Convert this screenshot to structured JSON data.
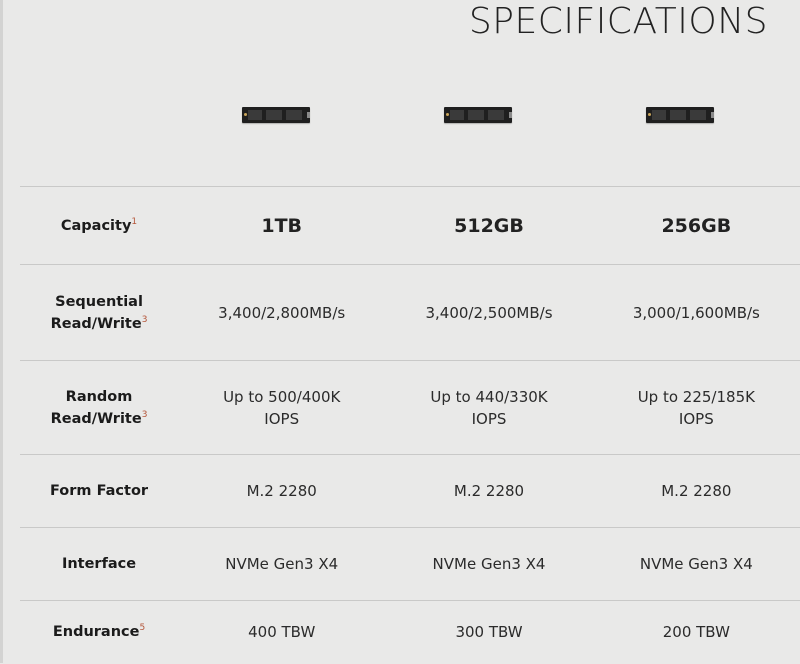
{
  "page": {
    "title": "SPECIFICATIONS"
  },
  "products": [
    {
      "image": "m2-ssd-1tb"
    },
    {
      "image": "m2-ssd-512gb"
    },
    {
      "image": "m2-ssd-256gb"
    }
  ],
  "colors": {
    "background": "#e9e9e8",
    "divider": "#c9c9c8",
    "footnote": "#b4563a",
    "text": "#1b1b1b"
  },
  "rows": [
    {
      "label": "Capacity",
      "footnote": "1",
      "values": [
        "1TB",
        "512GB",
        "256GB"
      ]
    },
    {
      "label_line1": "Sequential",
      "label_line2": "Read/Write",
      "footnote": "3",
      "values": [
        "3,400/2,800MB/s",
        "3,400/2,500MB/s",
        "3,000/1,600MB/s"
      ]
    },
    {
      "label": "Random Read/Write",
      "footnote": "3",
      "values_line1": [
        "Up to 500/400K",
        "Up to 440/330K",
        "Up to 225/185K"
      ],
      "values_line2": [
        "IOPS",
        "IOPS",
        "IOPS"
      ]
    },
    {
      "label": "Form Factor",
      "values": [
        "M.2 2280",
        "M.2 2280",
        "M.2 2280"
      ]
    },
    {
      "label": "Interface",
      "values": [
        "NVMe Gen3 X4",
        "NVMe Gen3 X4",
        "NVMe Gen3 X4"
      ]
    },
    {
      "label": "Endurance",
      "footnote": "5",
      "values": [
        "400 TBW",
        "300 TBW",
        "200 TBW"
      ]
    }
  ]
}
